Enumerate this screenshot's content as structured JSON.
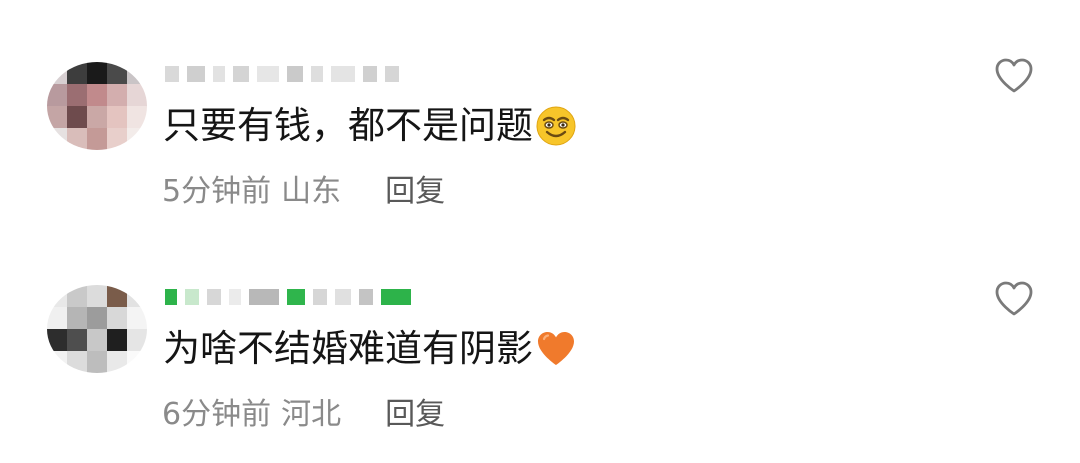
{
  "comments": [
    {
      "text": "只要有钱，都不是问题",
      "emoji": "grinning-face-emoji",
      "time": "5分钟前",
      "location": "山东",
      "reply_label": "回复",
      "like_icon": "heart-outline-icon"
    },
    {
      "text": "为啥不结婚难道有阴影",
      "emoji": "orange-heart-emoji",
      "time": "6分钟前",
      "location": "河北",
      "reply_label": "回复",
      "like_icon": "heart-outline-icon"
    }
  ],
  "colors": {
    "text": "#151515",
    "meta": "#8a8a8a",
    "reply": "#595959",
    "like_icon": "#7a7a7a",
    "username_blur_green": "#2db34a"
  }
}
